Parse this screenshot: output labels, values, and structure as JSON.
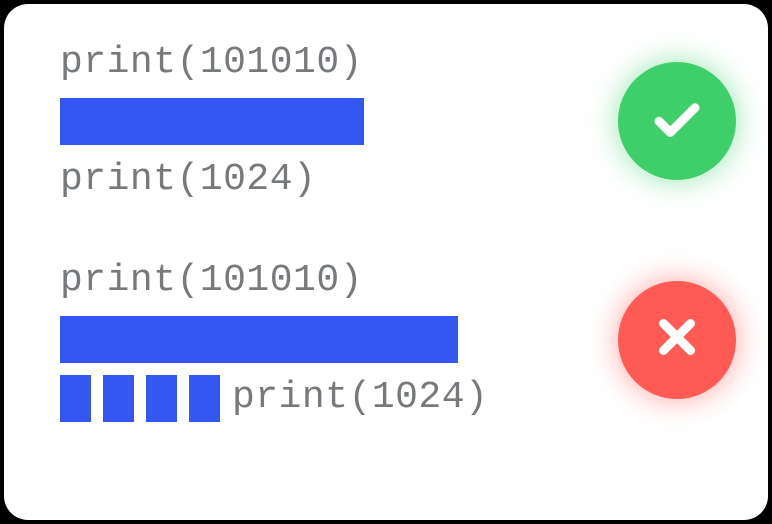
{
  "examples": {
    "correct": {
      "line1": "print(101010)",
      "line3": "print(1024)",
      "status": "success"
    },
    "incorrect": {
      "line1": "print(101010)",
      "line3": "print(1024)",
      "status": "error"
    }
  },
  "colors": {
    "highlight": "#3456f3",
    "success": "#3ecf6a",
    "error": "#ff5a56",
    "code_text": "#777a7d"
  }
}
